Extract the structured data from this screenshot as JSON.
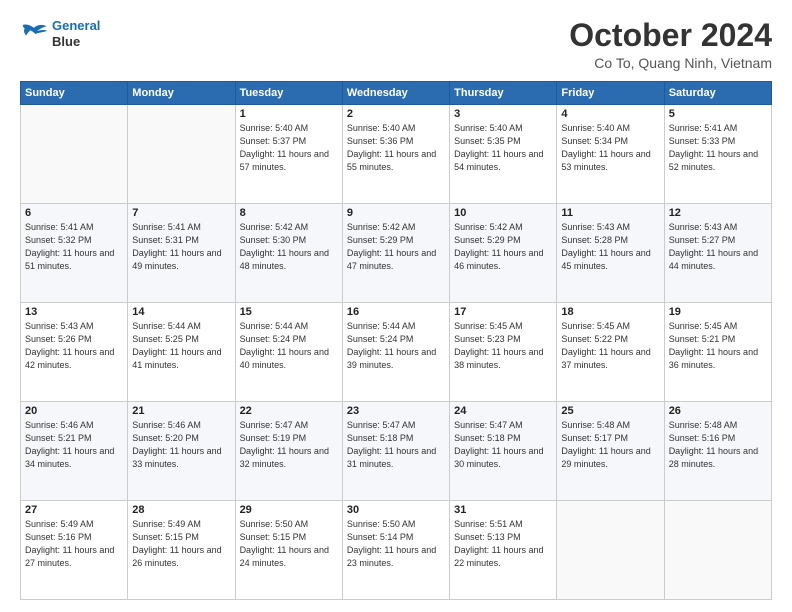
{
  "logo": {
    "line1": "General",
    "line2": "Blue"
  },
  "header": {
    "month": "October 2024",
    "location": "Co To, Quang Ninh, Vietnam"
  },
  "weekdays": [
    "Sunday",
    "Monday",
    "Tuesday",
    "Wednesday",
    "Thursday",
    "Friday",
    "Saturday"
  ],
  "weeks": [
    [
      {
        "day": "",
        "info": ""
      },
      {
        "day": "",
        "info": ""
      },
      {
        "day": "1",
        "info": "Sunrise: 5:40 AM\nSunset: 5:37 PM\nDaylight: 11 hours\nand 57 minutes."
      },
      {
        "day": "2",
        "info": "Sunrise: 5:40 AM\nSunset: 5:36 PM\nDaylight: 11 hours\nand 55 minutes."
      },
      {
        "day": "3",
        "info": "Sunrise: 5:40 AM\nSunset: 5:35 PM\nDaylight: 11 hours\nand 54 minutes."
      },
      {
        "day": "4",
        "info": "Sunrise: 5:40 AM\nSunset: 5:34 PM\nDaylight: 11 hours\nand 53 minutes."
      },
      {
        "day": "5",
        "info": "Sunrise: 5:41 AM\nSunset: 5:33 PM\nDaylight: 11 hours\nand 52 minutes."
      }
    ],
    [
      {
        "day": "6",
        "info": "Sunrise: 5:41 AM\nSunset: 5:32 PM\nDaylight: 11 hours\nand 51 minutes."
      },
      {
        "day": "7",
        "info": "Sunrise: 5:41 AM\nSunset: 5:31 PM\nDaylight: 11 hours\nand 49 minutes."
      },
      {
        "day": "8",
        "info": "Sunrise: 5:42 AM\nSunset: 5:30 PM\nDaylight: 11 hours\nand 48 minutes."
      },
      {
        "day": "9",
        "info": "Sunrise: 5:42 AM\nSunset: 5:29 PM\nDaylight: 11 hours\nand 47 minutes."
      },
      {
        "day": "10",
        "info": "Sunrise: 5:42 AM\nSunset: 5:29 PM\nDaylight: 11 hours\nand 46 minutes."
      },
      {
        "day": "11",
        "info": "Sunrise: 5:43 AM\nSunset: 5:28 PM\nDaylight: 11 hours\nand 45 minutes."
      },
      {
        "day": "12",
        "info": "Sunrise: 5:43 AM\nSunset: 5:27 PM\nDaylight: 11 hours\nand 44 minutes."
      }
    ],
    [
      {
        "day": "13",
        "info": "Sunrise: 5:43 AM\nSunset: 5:26 PM\nDaylight: 11 hours\nand 42 minutes."
      },
      {
        "day": "14",
        "info": "Sunrise: 5:44 AM\nSunset: 5:25 PM\nDaylight: 11 hours\nand 41 minutes."
      },
      {
        "day": "15",
        "info": "Sunrise: 5:44 AM\nSunset: 5:24 PM\nDaylight: 11 hours\nand 40 minutes."
      },
      {
        "day": "16",
        "info": "Sunrise: 5:44 AM\nSunset: 5:24 PM\nDaylight: 11 hours\nand 39 minutes."
      },
      {
        "day": "17",
        "info": "Sunrise: 5:45 AM\nSunset: 5:23 PM\nDaylight: 11 hours\nand 38 minutes."
      },
      {
        "day": "18",
        "info": "Sunrise: 5:45 AM\nSunset: 5:22 PM\nDaylight: 11 hours\nand 37 minutes."
      },
      {
        "day": "19",
        "info": "Sunrise: 5:45 AM\nSunset: 5:21 PM\nDaylight: 11 hours\nand 36 minutes."
      }
    ],
    [
      {
        "day": "20",
        "info": "Sunrise: 5:46 AM\nSunset: 5:21 PM\nDaylight: 11 hours\nand 34 minutes."
      },
      {
        "day": "21",
        "info": "Sunrise: 5:46 AM\nSunset: 5:20 PM\nDaylight: 11 hours\nand 33 minutes."
      },
      {
        "day": "22",
        "info": "Sunrise: 5:47 AM\nSunset: 5:19 PM\nDaylight: 11 hours\nand 32 minutes."
      },
      {
        "day": "23",
        "info": "Sunrise: 5:47 AM\nSunset: 5:18 PM\nDaylight: 11 hours\nand 31 minutes."
      },
      {
        "day": "24",
        "info": "Sunrise: 5:47 AM\nSunset: 5:18 PM\nDaylight: 11 hours\nand 30 minutes."
      },
      {
        "day": "25",
        "info": "Sunrise: 5:48 AM\nSunset: 5:17 PM\nDaylight: 11 hours\nand 29 minutes."
      },
      {
        "day": "26",
        "info": "Sunrise: 5:48 AM\nSunset: 5:16 PM\nDaylight: 11 hours\nand 28 minutes."
      }
    ],
    [
      {
        "day": "27",
        "info": "Sunrise: 5:49 AM\nSunset: 5:16 PM\nDaylight: 11 hours\nand 27 minutes."
      },
      {
        "day": "28",
        "info": "Sunrise: 5:49 AM\nSunset: 5:15 PM\nDaylight: 11 hours\nand 26 minutes."
      },
      {
        "day": "29",
        "info": "Sunrise: 5:50 AM\nSunset: 5:15 PM\nDaylight: 11 hours\nand 24 minutes."
      },
      {
        "day": "30",
        "info": "Sunrise: 5:50 AM\nSunset: 5:14 PM\nDaylight: 11 hours\nand 23 minutes."
      },
      {
        "day": "31",
        "info": "Sunrise: 5:51 AM\nSunset: 5:13 PM\nDaylight: 11 hours\nand 22 minutes."
      },
      {
        "day": "",
        "info": ""
      },
      {
        "day": "",
        "info": ""
      }
    ]
  ]
}
